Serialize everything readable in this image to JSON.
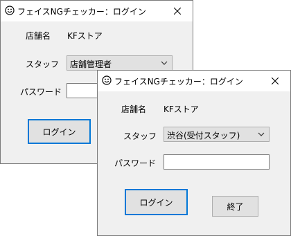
{
  "window_back": {
    "title": "フェイスNGチェッカー：ログイン",
    "store_label": "店舗名",
    "store_value": "KFストア",
    "staff_label": "スタッフ",
    "staff_selected": "店舗管理者",
    "password_label": "パスワード",
    "login_button": "ログイン"
  },
  "window_front": {
    "title": "フェイスNGチェッカー：ログイン",
    "store_label": "店舗名",
    "store_value": "KFストア",
    "staff_label": "スタッフ",
    "staff_selected": "渋谷(受付スタッフ)",
    "password_label": "パスワード",
    "password_value": "",
    "login_button": "ログイン",
    "exit_button": "終了"
  },
  "icons": {
    "app": "smiley-icon",
    "close": "close-icon",
    "dropdown": "chevron-down-icon"
  },
  "colors": {
    "accent": "#0078d7",
    "window_bg": "#f0f0f0",
    "titlebar_bg": "#ffffff",
    "button_bg": "#e1e1e1"
  }
}
